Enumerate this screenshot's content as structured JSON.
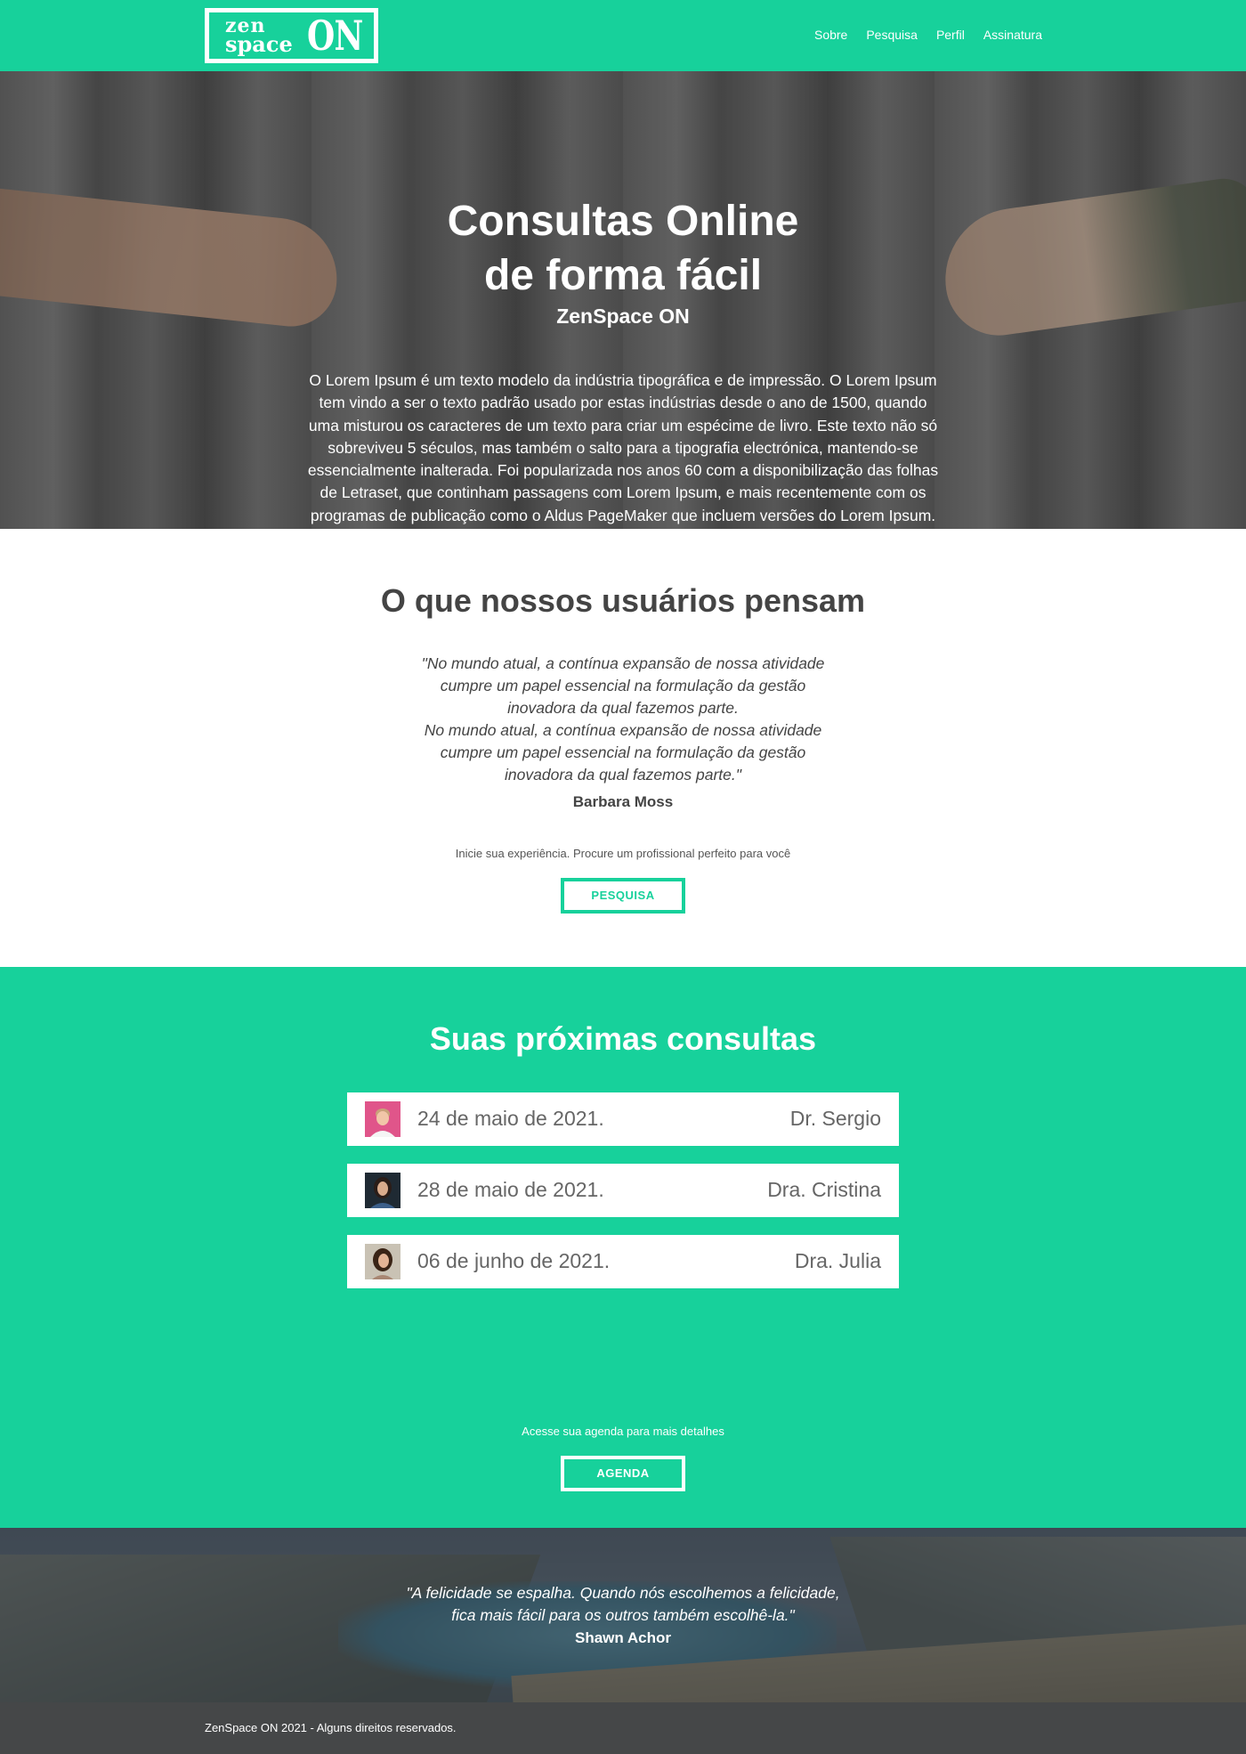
{
  "header": {
    "logo": {
      "line1": "zen",
      "line2": "space",
      "mark": "ON"
    },
    "nav": [
      "Sobre",
      "Pesquisa",
      "Perfil",
      "Assinatura"
    ]
  },
  "hero": {
    "title_line1": "Consultas Online",
    "title_line2": "de forma fácil",
    "subtitle": "ZenSpace ON",
    "body": "O Lorem Ipsum é um texto modelo da indústria tipográfica e de impressão. O Lorem Ipsum tem vindo a ser o texto padrão usado por estas indústrias desde o ano de 1500, quando uma misturou os caracteres de um texto para criar um espécime de livro. Este texto não só sobreviveu 5 séculos, mas também o salto para a tipografia electrónica, mantendo-se essencialmente inalterada. Foi popularizada nos anos 60 com a disponibilização das folhas de Letraset, que continham passagens com Lorem Ipsum, e mais recentemente com os programas de publicação como o Aldus PageMaker que incluem versões do Lorem Ipsum."
  },
  "testimonials": {
    "heading": "O que nossos usuários pensam",
    "quote_line1": "\"No mundo atual, a contínua expansão de nossa atividade cumpre um papel essencial na formulação da gestão inovadora da qual fazemos parte.",
    "quote_line2": "No mundo atual, a contínua expansão de nossa atividade cumpre um papel essencial na formulação da gestão inovadora da qual fazemos parte.\"",
    "author": "Barbara Moss",
    "cta_text": "Inicie sua experiência. Procure um profissional perfeito para você",
    "cta_button": "PESQUISA"
  },
  "appointments": {
    "heading": "Suas próximas consultas",
    "items": [
      {
        "date": "24 de maio de 2021.",
        "doctor": "Dr. Sergio",
        "avatar": "avatar-sergio"
      },
      {
        "date": "28 de maio de 2021.",
        "doctor": "Dra. Cristina",
        "avatar": "avatar-cristina"
      },
      {
        "date": "06 de junho de 2021.",
        "doctor": "Dra. Julia",
        "avatar": "avatar-julia"
      }
    ],
    "cta_text": "Acesse sua agenda para mais detalhes",
    "cta_button": "AGENDA"
  },
  "quote_band": {
    "quote_line1": "\"A felicidade se espalha. Quando nós escolhemos a felicidade,",
    "quote_line2": "fica mais fácil para os outros também escolhê-la.\"",
    "author": "Shawn Achor"
  },
  "footer": {
    "copyright": "ZenSpace ON 2021 - Alguns direitos reservados."
  },
  "colors": {
    "brand_green": "#17d19b",
    "footer_gray": "#454748",
    "text_dark": "#444444"
  }
}
